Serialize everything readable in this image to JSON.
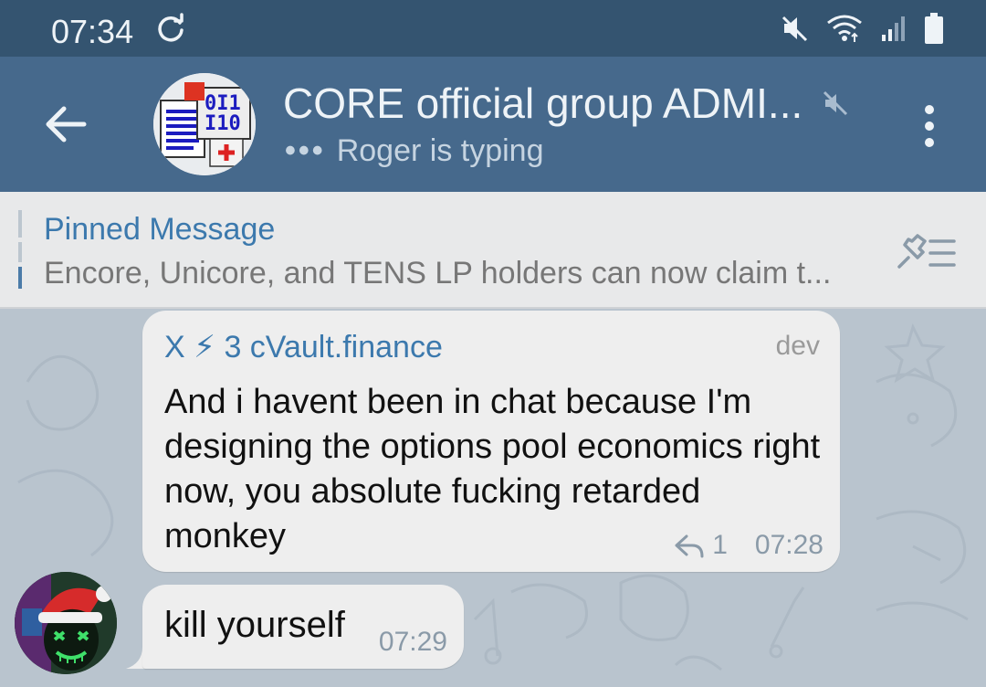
{
  "status": {
    "time": "07:34"
  },
  "header": {
    "title": "CORE official group ADMI...",
    "subtitle": "Roger is typing",
    "typing_dots": "•••"
  },
  "pinned": {
    "title": "Pinned Message",
    "text": "Encore, Unicore, and TENS LP holders can now claim t..."
  },
  "messages": [
    {
      "sender": "X ⚡ 3 cVault.finance",
      "role": "dev",
      "text": "And i havent been in chat because I'm designing the options pool economics right now, you absolute fucking retarded monkey",
      "replies": "1",
      "time": "07:28"
    },
    {
      "text": "kill yourself",
      "time": "07:29"
    }
  ],
  "colors": {
    "status_bar": "#345470",
    "app_bar": "#46698c",
    "accent": "#3c79ad",
    "bubble": "#eeeeee",
    "chat_bg": "#b9c4ce"
  }
}
